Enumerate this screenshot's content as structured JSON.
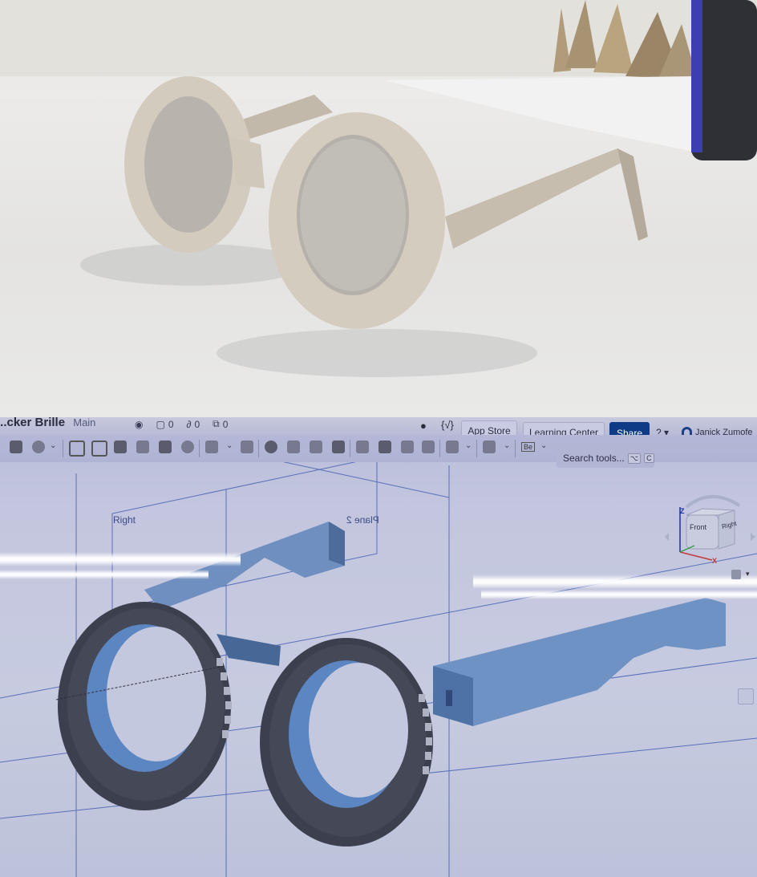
{
  "photo": {
    "subject": "cardboard-round-eyeglasses-prototype",
    "colors": {
      "frame": "#cfc6b8",
      "lens": "#b8b4ad",
      "table": "#e6e5e3",
      "object_blue": "#2a2f8a"
    }
  },
  "cad": {
    "document": {
      "title": "...cker Brille",
      "branch": "Main"
    },
    "counters": [
      {
        "icon": "eye-icon",
        "value": ""
      },
      {
        "icon": "comment-box-icon",
        "value": "0"
      },
      {
        "icon": "link-icon",
        "value": "0"
      },
      {
        "icon": "copy-icon",
        "value": "0"
      }
    ],
    "header": {
      "comment_icon": "speech-bubble-icon",
      "variables_label": "{√}",
      "app_store_label": "App Store",
      "learning_center_label": "Learning Center",
      "share_label": "Share",
      "help_label": "?",
      "user_name": "Janick Zumofe"
    },
    "toolbar": {
      "search_placeholder": "Search tools...",
      "shortcut_keys": [
        "⌥",
        "C"
      ],
      "be_badge": "Be"
    },
    "viewport": {
      "plane_labels": [
        "Right",
        "Plane 2"
      ],
      "view_cube": {
        "front": "Front",
        "right": "Right",
        "axis_z": "Z",
        "axis_x": "X"
      }
    },
    "colors": {
      "share_bg": "#0f3a86",
      "model_blue": "#5b84b8",
      "rim_dark": "#3d4150",
      "background": "#c4c8de"
    }
  }
}
